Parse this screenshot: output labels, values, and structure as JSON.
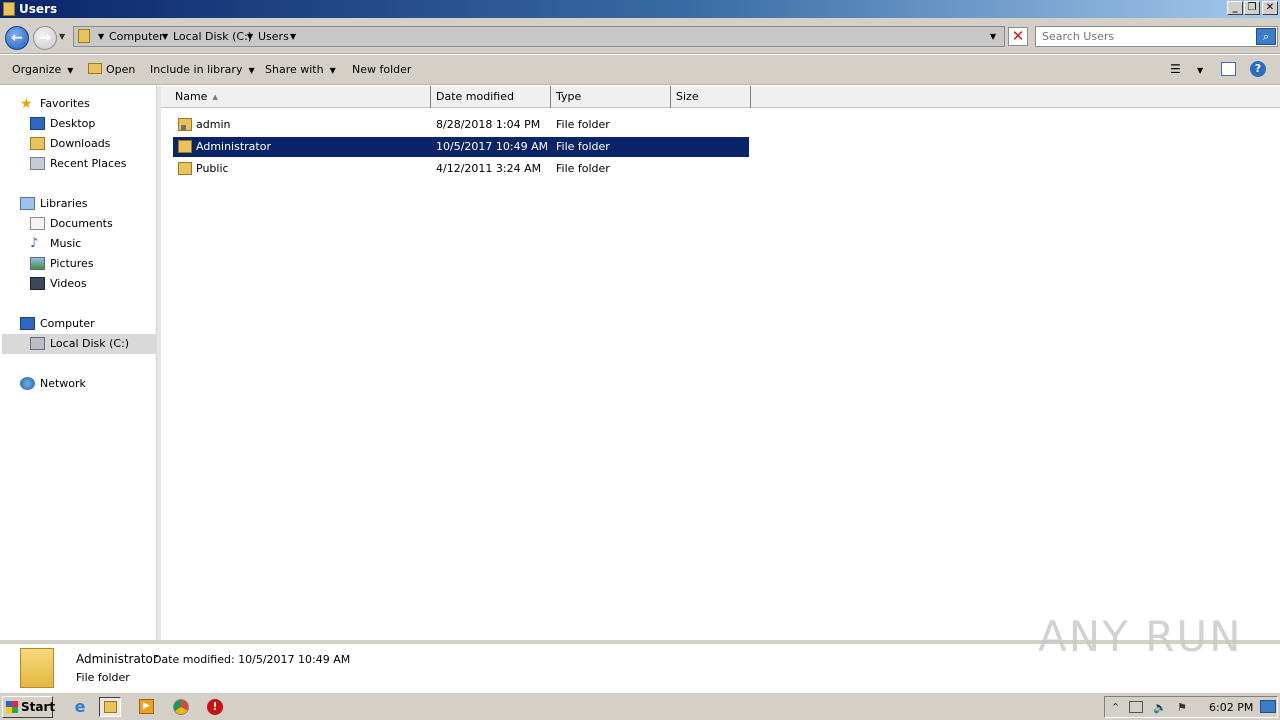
{
  "window": {
    "title": "Users",
    "minimize": "_",
    "restore": "❐",
    "close": "✕"
  },
  "address": {
    "crumbs": [
      "Computer",
      "Local Disk (C:)",
      "Users"
    ],
    "search_placeholder": "Search Users"
  },
  "toolbar": {
    "organize": "Organize",
    "open": "Open",
    "include_in_library": "Include in library",
    "share_with": "Share with",
    "new_folder": "New folder"
  },
  "nav": {
    "favorites": "Favorites",
    "desktop": "Desktop",
    "downloads": "Downloads",
    "recent_places": "Recent Places",
    "libraries": "Libraries",
    "documents": "Documents",
    "music": "Music",
    "pictures": "Pictures",
    "videos": "Videos",
    "computer": "Computer",
    "local_disk": "Local Disk (C:)",
    "network": "Network"
  },
  "columns": {
    "name": "Name",
    "date_modified": "Date modified",
    "type": "Type",
    "size": "Size"
  },
  "files": [
    {
      "name": "admin",
      "date": "8/28/2018 1:04 PM",
      "type": "File folder",
      "size": ""
    },
    {
      "name": "Administrator",
      "date": "10/5/2017 10:49 AM",
      "type": "File folder",
      "size": ""
    },
    {
      "name": "Public",
      "date": "4/12/2011 3:24 AM",
      "type": "File folder",
      "size": ""
    }
  ],
  "details": {
    "name": "Administrator",
    "modified": "Date modified: 10/5/2017 10:49 AM",
    "type": "File folder"
  },
  "watermark": "ANY RUN",
  "taskbar": {
    "start": "Start",
    "clock": "6:02 PM"
  },
  "colors": {
    "selection": "#0a246a",
    "chrome": "#d4d0c8"
  }
}
